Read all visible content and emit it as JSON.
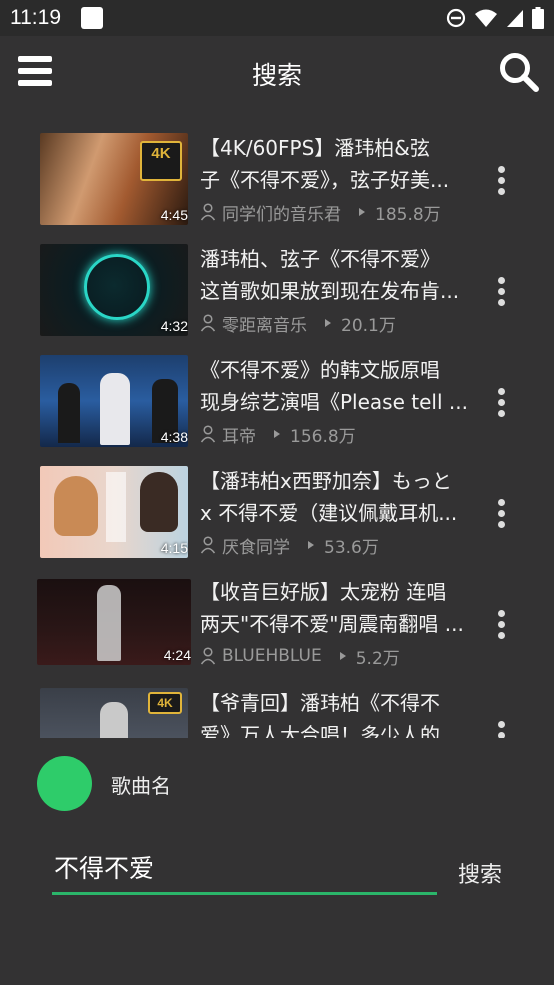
{
  "status_bar": {
    "time": "11:19"
  },
  "app_bar": {
    "title": "搜索"
  },
  "videos": [
    {
      "title_line1": "【4K/60FPS】潘玮柏&弦",
      "title_line2": "子《不得不爱》，弦子好美...",
      "author": "同学们的音乐君",
      "views": "185.8万",
      "duration": "4:45",
      "badge": "4K"
    },
    {
      "title_line1": "潘玮柏、弦子《不得不爱》",
      "title_line2": "这首歌如果放到现在发布肯...",
      "author": "零距离音乐",
      "views": "20.1万",
      "duration": "4:32",
      "badge": ""
    },
    {
      "title_line1": "《不得不爱》的韩文版原唱",
      "title_line2": "现身综艺演唱《Please tell ...",
      "author": "耳帝",
      "views": "156.8万",
      "duration": "4:38",
      "badge": ""
    },
    {
      "title_line1": "【潘玮柏x西野加奈】もっと",
      "title_line2": "x 不得不爱（建议佩戴耳机...",
      "author": "厌食同学",
      "views": "53.6万",
      "duration": "4:15",
      "badge": ""
    },
    {
      "title_line1": "【收音巨好版】太宠粉 连唱",
      "title_line2": "两天\"不得不爱\"周震南翻唱 ...",
      "author": "BLUEHBLUE",
      "views": "5.2万",
      "duration": "4:24",
      "badge": ""
    },
    {
      "title_line1": "【爷青回】潘玮柏《不得不",
      "title_line2": "爱》万人大合唱！多少人的",
      "author": "",
      "views": "",
      "duration": "",
      "badge": "4K"
    }
  ],
  "player": {
    "song_label": "歌曲名",
    "avatar_color": "#2ecc6a"
  },
  "search_box": {
    "value": "不得不爱",
    "button_label": "搜索",
    "accent": "#2bb56a"
  }
}
